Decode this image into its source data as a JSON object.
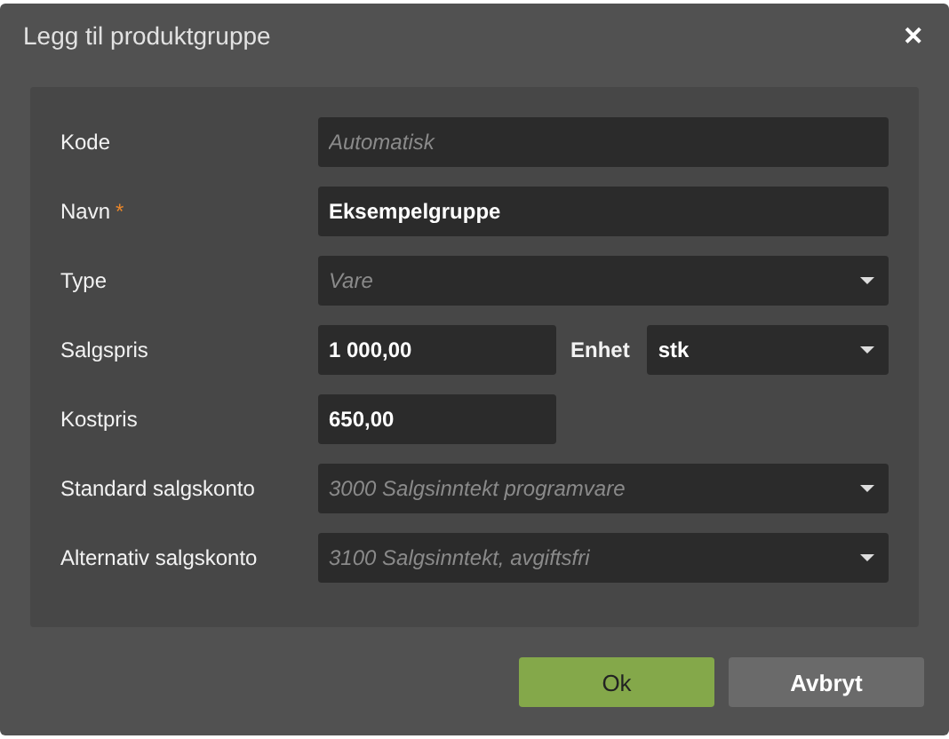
{
  "dialog": {
    "title": "Legg til produktgruppe",
    "close": "✕"
  },
  "rows": [
    {
      "label": "Kode",
      "required_mark": null,
      "fields": [
        {
          "kind": "text",
          "placeholder": "Automatisk"
        }
      ]
    },
    {
      "label": "Navn",
      "required_mark": "*",
      "fields": [
        {
          "kind": "text",
          "value": "Eksempelgruppe"
        }
      ]
    },
    {
      "label": "Type",
      "required_mark": null,
      "fields": [
        {
          "kind": "select",
          "placeholder": "Vare"
        }
      ]
    },
    {
      "label": "Salgspris",
      "required_mark": null,
      "fields": [
        {
          "kind": "amount",
          "value": "1 000,00"
        },
        {
          "kind": "select",
          "label": "Enhet",
          "value": "stk"
        }
      ]
    },
    {
      "label": "Kostpris",
      "required_mark": null,
      "fields": [
        {
          "kind": "amount",
          "value": "650,00"
        }
      ]
    },
    {
      "label": "Standard salgskonto",
      "required_mark": null,
      "fields": [
        {
          "kind": "select",
          "placeholder": "3000 Salgsinntekt programvare"
        }
      ]
    },
    {
      "label": "Alternativ salgskonto",
      "required_mark": null,
      "fields": [
        {
          "kind": "select",
          "placeholder": "3100 Salgsinntekt, avgiftsfri"
        }
      ]
    }
  ],
  "buttons": [
    {
      "kind": "primary",
      "label": "Ok"
    },
    {
      "kind": "secondary",
      "label": "Avbryt"
    }
  ]
}
